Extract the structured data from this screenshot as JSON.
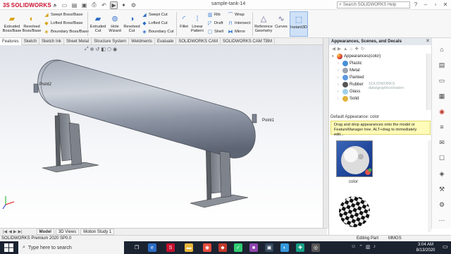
{
  "app": {
    "brand_prefix": "3S",
    "brand_name": "SOLIDWORKS",
    "doc_title": "sample-tank-14",
    "search_placeholder": "Search SOLIDWORKS Help"
  },
  "ribbon": {
    "large_tools": [
      {
        "label": "Extruded\nBoss/Base",
        "icon": "extruded-boss-icon"
      },
      {
        "label": "Revolved\nBoss/Base",
        "icon": "revolved-boss-icon"
      },
      {
        "label": "Extruded\nCut",
        "icon": "extruded-cut-icon"
      },
      {
        "label": "Hole\nWizard",
        "icon": "hole-wizard-icon"
      },
      {
        "label": "Revolved\nCut",
        "icon": "revolved-cut-icon"
      },
      {
        "label": "Fillet",
        "icon": "fillet-icon"
      },
      {
        "label": "Linear\nPattern",
        "icon": "linear-pattern-icon"
      },
      {
        "label": "Reference\nGeometry",
        "icon": "reference-geometry-icon"
      },
      {
        "label": "Curves",
        "icon": "curves-icon"
      },
      {
        "label": "Instant3D",
        "icon": "instant3d-icon"
      }
    ],
    "small_tools": [
      {
        "label": "Swept Boss/Base"
      },
      {
        "label": "Lofted Boss/Base"
      },
      {
        "label": "Boundary Boss/Base"
      },
      {
        "label": "Swept Cut"
      },
      {
        "label": "Lofted Cut"
      },
      {
        "label": "Boundary Cut"
      },
      {
        "label": "Rib"
      },
      {
        "label": "Draft"
      },
      {
        "label": "Shell"
      },
      {
        "label": "Wrap"
      },
      {
        "label": "Intersect"
      },
      {
        "label": "Mirror"
      }
    ]
  },
  "cm_tabs": [
    "Features",
    "Sketch",
    "Sketch Ink",
    "Sheet Metal",
    "Structure System",
    "Weldments",
    "Evaluate",
    "SOLIDWORKS CAM",
    "SOLIDWORKS CAM TBM"
  ],
  "viewport": {
    "point_left": "Point2",
    "point_right": "Point1"
  },
  "appearances_pane": {
    "title": "Appearances, Scenes, and Decals",
    "tree_root": "Appearances(color)",
    "tree_items": [
      "Plastic",
      "Metal",
      "Painted",
      "Rubber",
      "Glass",
      "Solid"
    ],
    "library_path": "SOLIDWORKS data\\graphics\\materi",
    "default_label": "Default Appearance: color",
    "tip": "Drag and drop appearances onto the model or FeatureManager tree.  ALT+drag to immediately edit...",
    "preview_label": "color"
  },
  "bottom_tabs": [
    "Model",
    "3D Views",
    "Motion Study 1"
  ],
  "status": {
    "left": "SOLIDWORKS Premium 2020 SP0.0",
    "mode": "Editing Part",
    "units": "MMGS"
  },
  "taskbar": {
    "search_placeholder": "Type here to search",
    "time": "3:04 AM",
    "date": "8/13/2020"
  },
  "colors": {
    "brand_red": "#c8102e",
    "tank_gray": "#8f97a6",
    "taskbar": "#1b2331",
    "tip_yellow": "#fffbb8"
  }
}
